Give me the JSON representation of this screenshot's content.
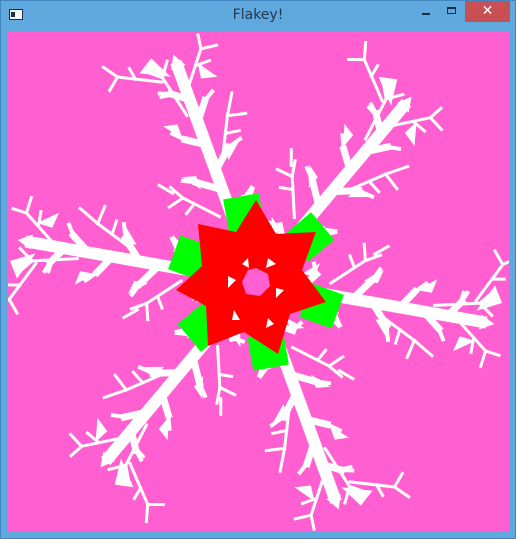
{
  "window": {
    "title": "Flakey!",
    "app_icon": "window-app-icon",
    "controls": {
      "minimize_icon": "minimize-icon",
      "maximize_icon": "maximize-icon",
      "close_label": "✕"
    }
  },
  "canvas": {
    "background_color": "#ff5fd1",
    "flake_color": "#ffffff",
    "core_color": "#ff0000",
    "core_points_color": "#00ff00",
    "center_color": "#ff5fd1",
    "center_marker_color": "#ffffff"
  }
}
